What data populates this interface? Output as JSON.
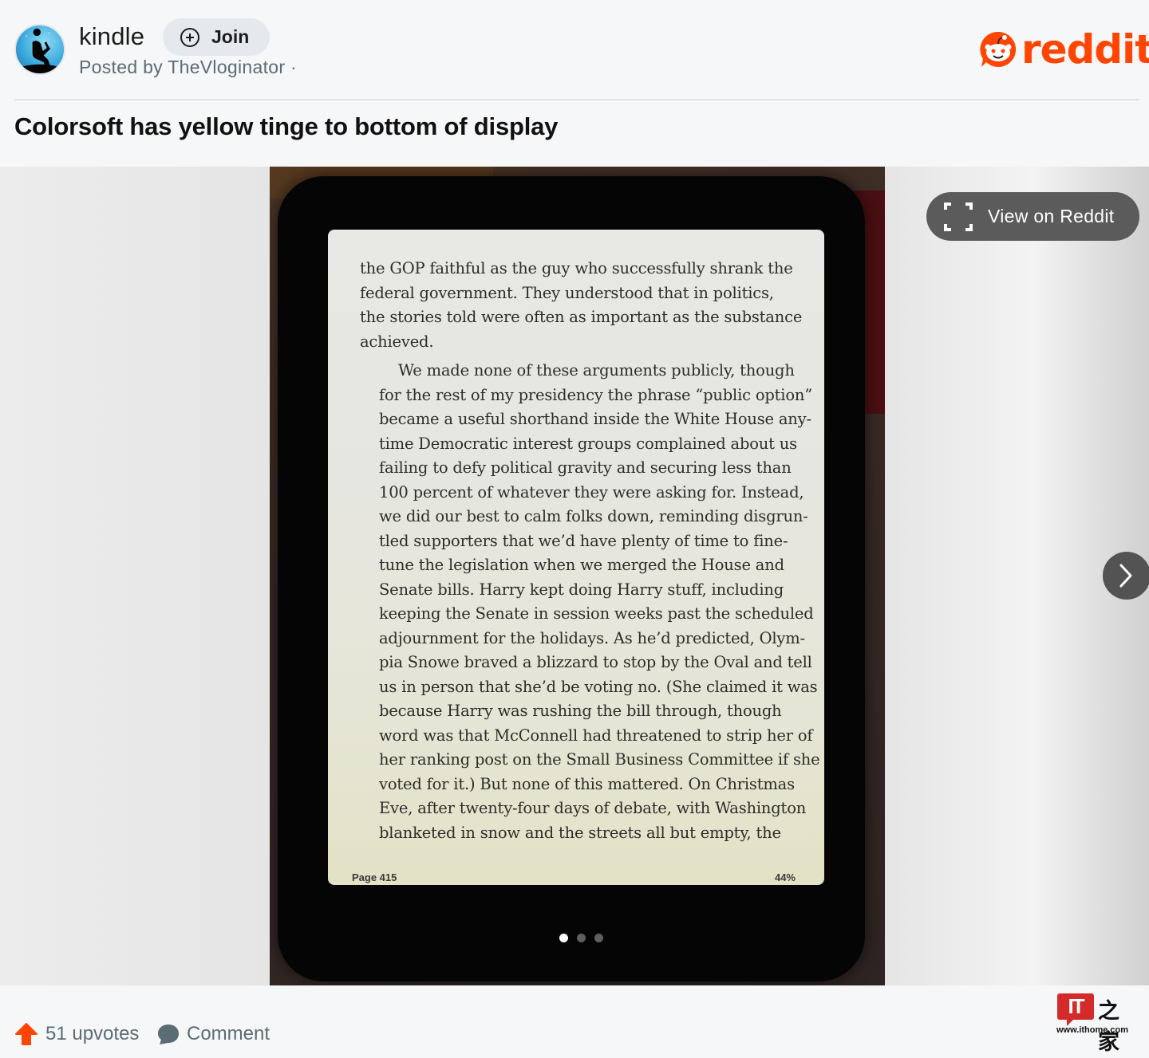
{
  "header": {
    "subreddit": "kindle",
    "join_label": "Join",
    "posted_by": "Posted by TheVloginator ·",
    "brand": "reddit",
    "brand_color": "#ff4500"
  },
  "post": {
    "title": "Colorsoft has yellow tinge to bottom of display"
  },
  "media": {
    "view_button_label": "View on Reddit",
    "view_button_icon": "expand-icon",
    "next_icon": "chevron-right-icon",
    "carousel": {
      "count": 3,
      "active_index": 0
    },
    "kindle_screen": {
      "paragraphs": [
        {
          "indent": false,
          "lines": [
            "the GOP faithful as the guy who successfully shrank the",
            "federal government. They understood that in politics,",
            "the stories told were often as important as the substance",
            "achieved."
          ]
        },
        {
          "indent": true,
          "lines": [
            "We made none of these arguments publicly, though",
            "for the rest of my presidency the phrase “public option”",
            "became a useful shorthand inside the White House any-",
            "time Democratic interest groups complained about us",
            "failing to defy political gravity and securing less than",
            "100 percent of whatever they were asking for. Instead,",
            "we did our best to calm folks down, reminding disgrun-",
            "tled supporters that we’d have plenty of time to fine-",
            "tune the legislation when we merged the House and",
            "Senate bills. Harry kept doing Harry stuff, including",
            "keeping the Senate in session weeks past the scheduled",
            "adjournment for the holidays. As he’d predicted, Olym-",
            "pia Snowe braved a blizzard to stop by the Oval and tell",
            "us in person that she’d be voting no. (She claimed it was",
            "because Harry was rushing the bill through, though",
            "word was that McConnell had threatened to strip her of",
            "her ranking post on the Small Business Committee if she",
            "voted for it.) But none of this mattered. On Christmas",
            "Eve, after twenty-four days of debate, with Washington",
            "blanketed in snow and the streets all but empty, the"
          ]
        }
      ],
      "page_label": "Page 415",
      "progress_label": "44%",
      "progress_percent": 44
    }
  },
  "footer": {
    "upvotes_label": "51 upvotes",
    "comment_label": "Comment",
    "upvote_color": "#ff4500",
    "watermark": {
      "badge": "IT",
      "chinese": "之家",
      "url": "www.ithome.com"
    }
  }
}
